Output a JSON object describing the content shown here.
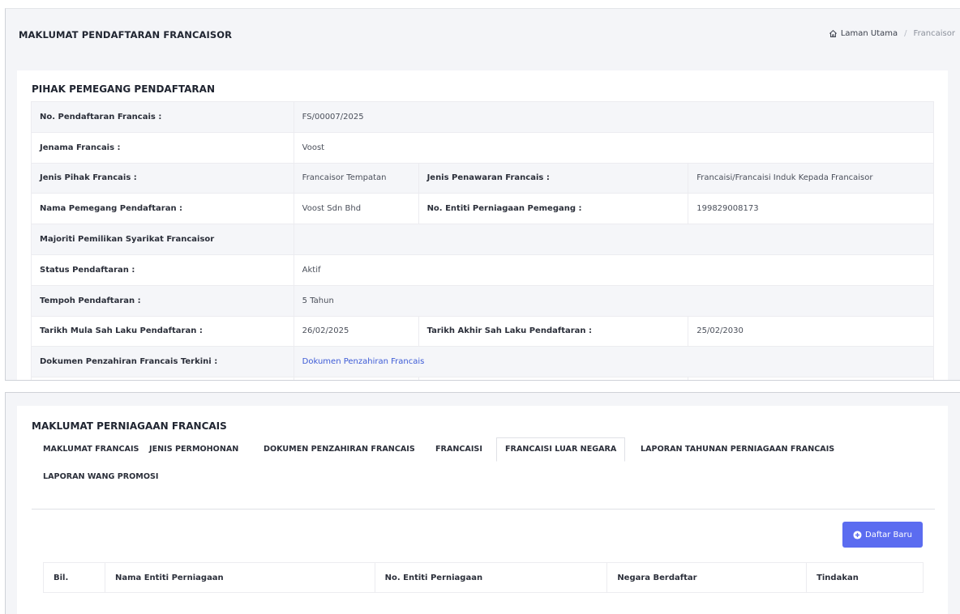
{
  "header": {
    "title": "MAKLUMAT PENDAFTARAN FRANCAISOR",
    "breadcrumb": {
      "home": "Laman Utama",
      "current": "Francaisor"
    }
  },
  "registration": {
    "section_title": "PIHAK PEMEGANG PENDAFTARAN",
    "rows": [
      {
        "label": "No. Pendaftaran Francais :",
        "value": "FS/00007/2025"
      },
      {
        "label": "Jenama Francais :",
        "value": "Voost"
      },
      {
        "label": "Jenis Pihak Francais :",
        "value": "Francaisor Tempatan",
        "label2": "Jenis Penawaran Francais :",
        "value2": "Francaisi/Francaisi Induk Kepada Francaisor"
      },
      {
        "label": "Nama Pemegang Pendaftaran :",
        "value": "Voost Sdn Bhd",
        "label2": "No. Entiti Perniagaan Pemegang :",
        "value2": "199829008173"
      },
      {
        "label": "Majoriti Pemilikan Syarikat Francaisor",
        "value": ""
      },
      {
        "label": "Status Pendaftaran :",
        "value": "Aktif"
      },
      {
        "label": "Tempoh Pendaftaran :",
        "value": "5 Tahun"
      },
      {
        "label": "Tarikh Mula Sah Laku Pendaftaran :",
        "value": "26/02/2025",
        "label2": "Tarikh Akhir Sah Laku Pendaftaran :",
        "value2": "25/02/2030"
      },
      {
        "label": "Dokumen Penzahiran Francais Terkini :",
        "link": "Dokumen Penzahiran Francais"
      }
    ]
  },
  "business": {
    "section_title": "MAKLUMAT PERNIAGAAN FRANCAIS",
    "tabs": [
      "MAKLUMAT FRANCAIS",
      "JENIS PERMOHONAN",
      "DOKUMEN PENZAHIRAN FRANCAIS",
      "FRANCAISI",
      "FRANCAISI LUAR NEGARA",
      "LAPORAN TAHUNAN PERNIAGAAN FRANCAIS",
      "LAPORAN WANG PROMOSI"
    ],
    "active_tab": "FRANCAISI LUAR NEGARA",
    "add_button": "Daftar Baru",
    "columns": [
      "Bil.",
      "Nama Entiti Perniagaan",
      "No. Entiti Perniagaan",
      "Negara Berdaftar",
      "Tindakan"
    ]
  },
  "colors": {
    "primary": "#5b6cf0",
    "link": "#3d5bd6",
    "panel_bg": "#f4f5f8"
  },
  "icons": {
    "breadcrumb_home": "home-icon",
    "add_button": "plus-circle-icon"
  }
}
